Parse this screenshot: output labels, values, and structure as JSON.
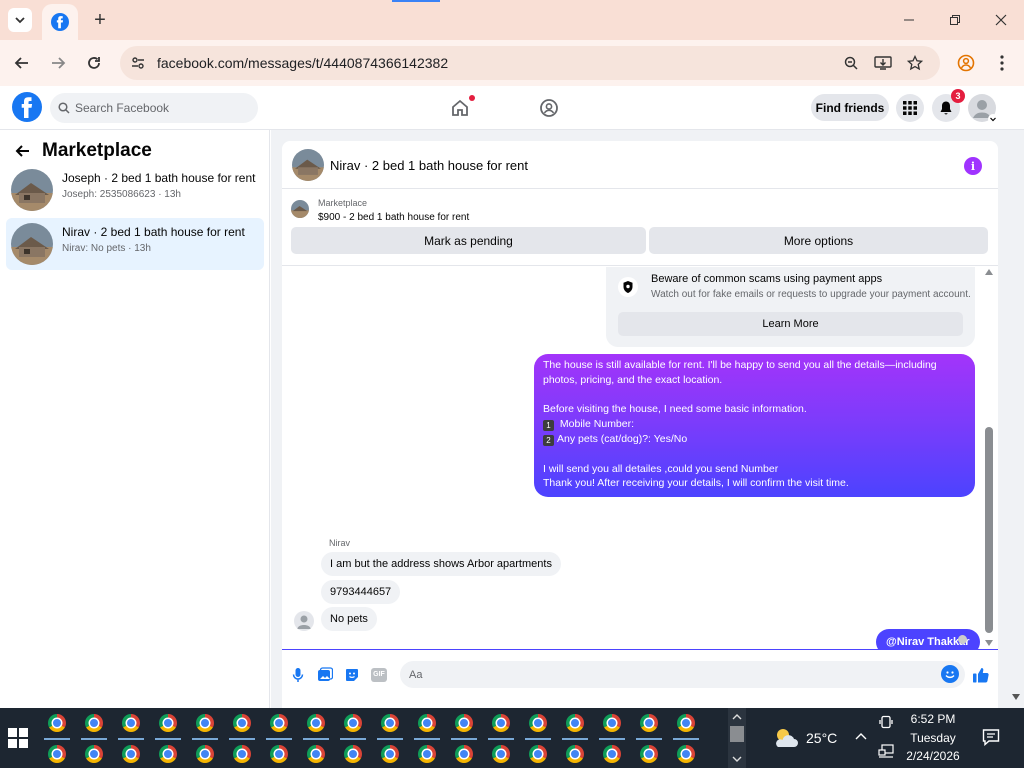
{
  "browser": {
    "url": "facebook.com/messages/t/4440874366142382",
    "tab_icon": "facebook-icon",
    "new_tab_label": "+"
  },
  "facebook": {
    "search_placeholder": "Search Facebook",
    "find_friends_label": "Find friends",
    "notifications_count": "3",
    "brand_color": "#1877f2"
  },
  "sidebar": {
    "title": "Marketplace",
    "conversations": [
      {
        "title": "Joseph · 2 bed 1 bath house for rent",
        "preview": "Joseph: 2535086623 · 13h",
        "active": false
      },
      {
        "title": "Nirav · 2 bed 1 bath house for rent",
        "preview": "Nirav: No pets · 13h",
        "active": true
      }
    ]
  },
  "chat": {
    "title": "Nirav · 2 bed 1 bath house for rent",
    "listing": {
      "category": "Marketplace",
      "title": "$900 - 2 bed 1 bath house for rent",
      "mark_pending_label": "Mark as pending",
      "more_options_label": "More options"
    },
    "scam_notice": {
      "title": "Beware of common scams using payment apps",
      "subtitle": "Watch out for fake emails or requests to upgrade your payment account.",
      "button": "Learn More"
    },
    "outgoing": {
      "line1": "The house is still available for rent. I'll be happy to send you all the details—including",
      "line2": "photos, pricing, and the exact location.",
      "line3": "Before visiting the house, I need some basic information.",
      "key1": "1",
      "item1": " Mobile Number:",
      "key2": "2",
      "item2": "Any pets (cat/dog)?: Yes/No",
      "line4": "I will send you all detailes ,could you send Number",
      "line5": "Thank you! After receiving your details, I will confirm the visit time."
    },
    "mention": "@Nirav Thakkar",
    "incoming": {
      "sender": "Nirav",
      "messages": [
        "I am but the address shows Arbor apartments",
        "9793444657",
        "No pets"
      ]
    },
    "composer_placeholder": "Aa",
    "gif_label": "GIF",
    "accent_color": "#4c43ff"
  },
  "taskbar": {
    "temperature": "25°C",
    "time": "6:52 PM",
    "day": "Tuesday",
    "date": "2/24/2026",
    "app_count": 36
  }
}
